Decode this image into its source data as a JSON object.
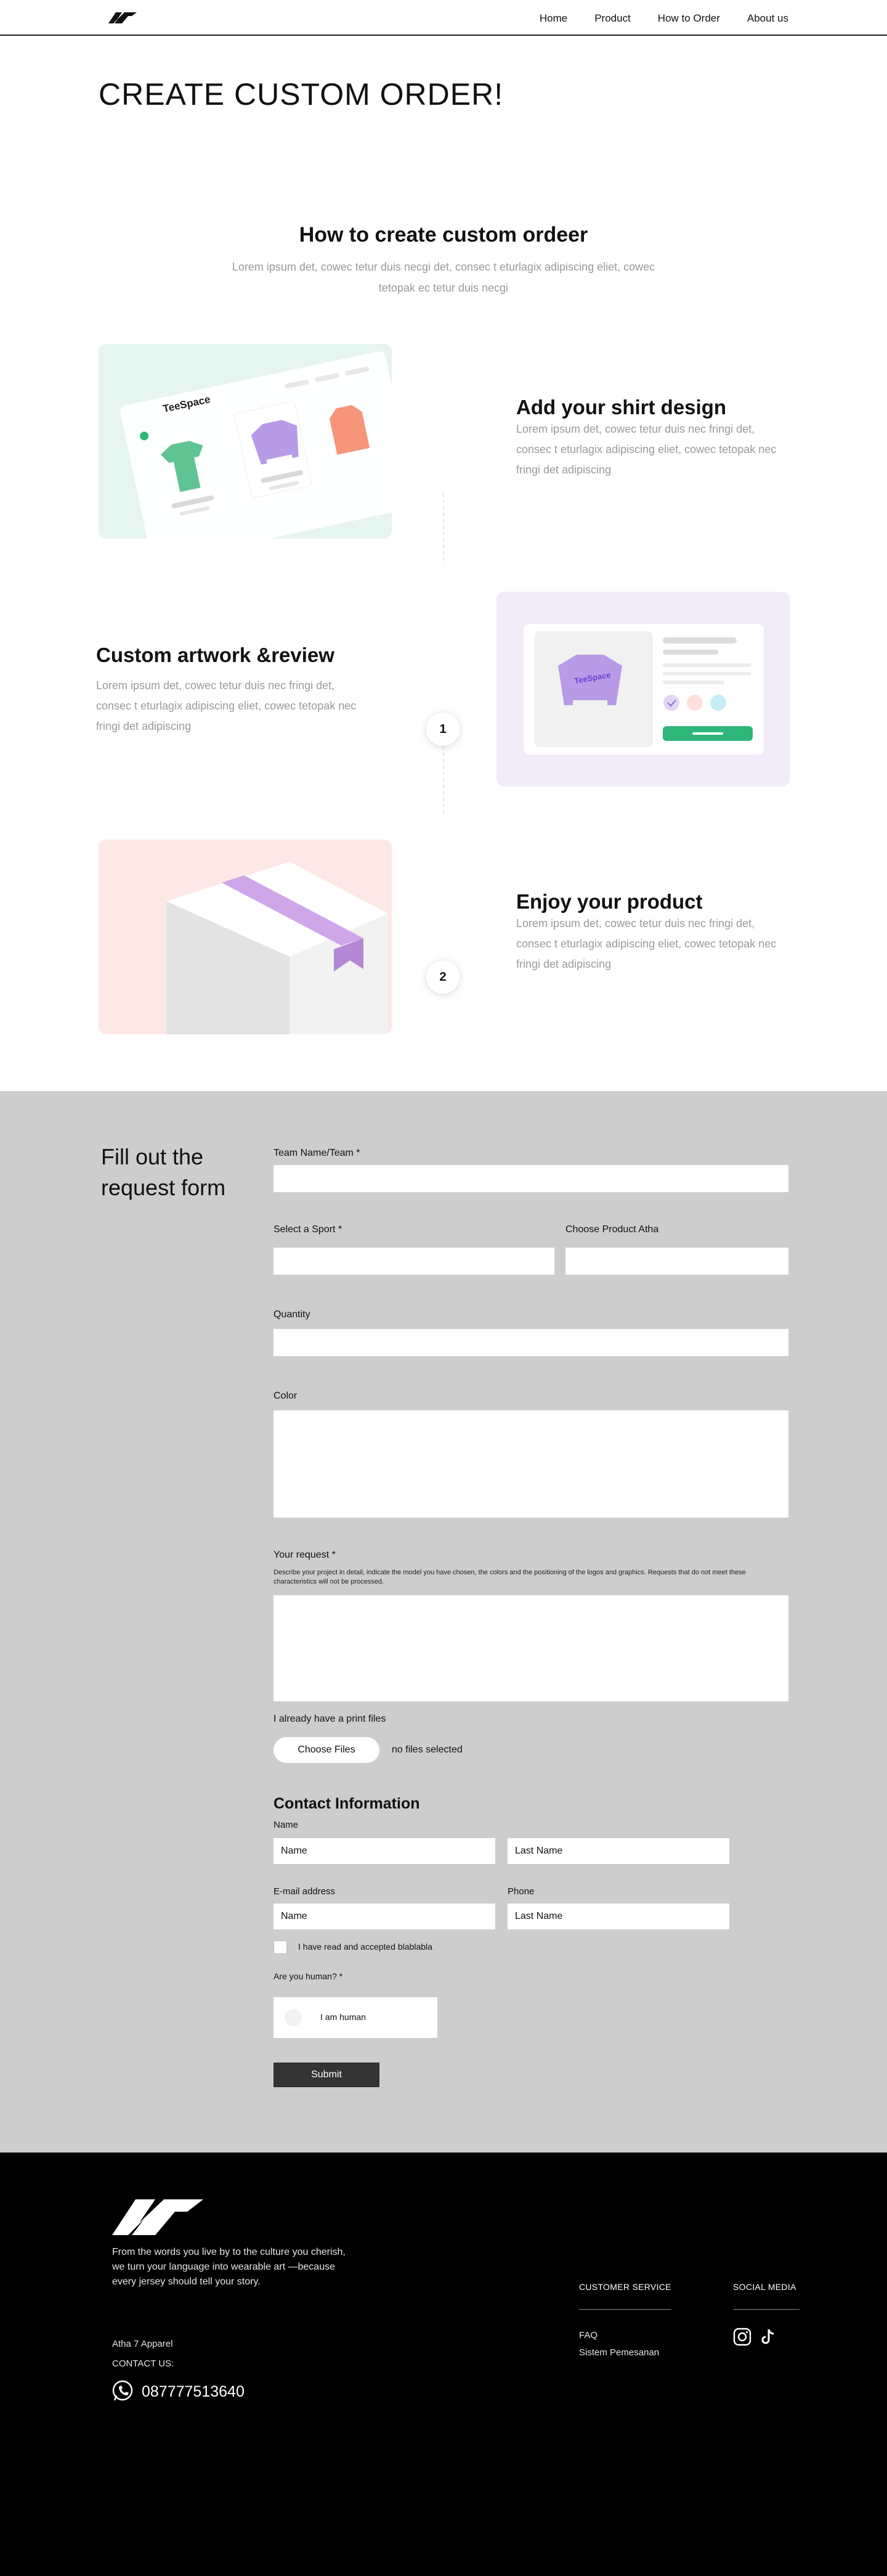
{
  "nav": {
    "logo": "logo-icon",
    "links": [
      "Home",
      "Product",
      "How to Order",
      "About us"
    ]
  },
  "page_title": "CREATE CUSTOM ORDER!",
  "how": {
    "title": "How to create custom ordeer",
    "subtitle": "Lorem ipsum det, cowec tetur duis necgi det, consec t eturlagix adipiscing eliet, cowec tetopak ec tetur duis necgi"
  },
  "steps": [
    {
      "title": "Add your shirt design",
      "desc": "Lorem ipsum det, cowec tetur duis nec fringi det, consec t eturlagix adipiscing eliet, cowec tetopak nec fringi det adipiscing",
      "brand": "TeeSpace"
    },
    {
      "number": "1",
      "title": "Custom artwork &review",
      "desc": "Lorem ipsum det, cowec tetur duis nec fringi det, consec t eturlagix adipiscing eliet, cowec tetopak nec fringi det adipiscing",
      "brand": "TeeSpace"
    },
    {
      "number": "2",
      "title": "Enjoy your product",
      "desc": "Lorem ipsum det, cowec tetur duis nec fringi det, consec t eturlagix adipiscing eliet, cowec tetopak nec fringi det adipiscing"
    }
  ],
  "form": {
    "heading_line1": "Fill out the",
    "heading_line2": "request form",
    "team_label": "Team Name/Team *",
    "sport_label": "Select a Sport *",
    "product_label": "Choose Product Atha",
    "quantity_label": "Quantity",
    "color_label": "Color",
    "request_label": "Your request *",
    "request_note": "Describe your project in detail, indicate the model you have chosen, the colors and the positioning of the logos and graphics. Requests that do not meet these characteristics will not be processed.",
    "print_label": "I already have a print files",
    "choose_files": "Choose Files",
    "no_files": "no files selected",
    "contact_title": "Contact Information",
    "name_label": "Name",
    "first_name_value": "Name",
    "last_name_value": "Last Name",
    "email_label": "E-mail address",
    "phone_label": "Phone",
    "email_value": "Name",
    "phone_value": "Last Name",
    "accept_label": "I have read and accepted blablabla",
    "human_label": "Are you human? *",
    "captcha_text": "I am human",
    "submit": "Submit"
  },
  "footer": {
    "logo": "logo-icon",
    "tagline": "From the words you live by to the culture you cherish, we turn your language into wearable art —because every jersey should tell your story.",
    "address": "Atha 7 Apparel",
    "contact_label": "CONTACT US:",
    "phone": "087777513640",
    "customer_service_title": "CUSTOMER SERVICE",
    "customer_links": [
      "FAQ",
      "Sistem Pemesanan"
    ],
    "social_title": "SOCIAL MEDIA",
    "social_icons": [
      "instagram-icon",
      "tiktok-icon"
    ]
  },
  "colors": {
    "form_bg": "#cdcdcd",
    "footer_bg": "#000000",
    "step1_bg": "#e6f5ef",
    "step2_bg": "#f1ebfa",
    "step3_bg": "#fde8e6",
    "accent_purple": "#b89be6",
    "accent_green": "#2fb67a"
  }
}
